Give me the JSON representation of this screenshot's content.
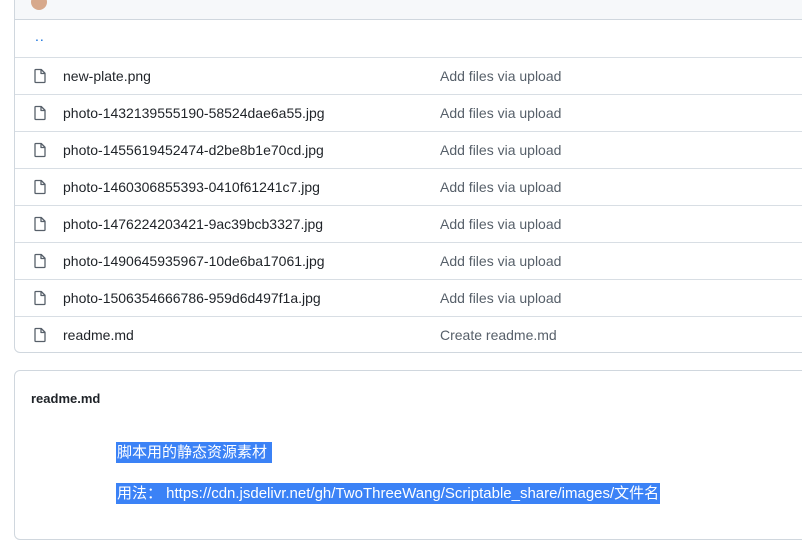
{
  "header": {
    "author_snippet": "…"
  },
  "parent_dir": "..",
  "files": [
    {
      "name": "new-plate.png",
      "commit": "Add files via upload"
    },
    {
      "name": "photo-1432139555190-58524dae6a55.jpg",
      "commit": "Add files via upload"
    },
    {
      "name": "photo-1455619452474-d2be8b1e70cd.jpg",
      "commit": "Add files via upload"
    },
    {
      "name": "photo-1460306855393-0410f61241c7.jpg",
      "commit": "Add files via upload"
    },
    {
      "name": "photo-1476224203421-9ac39bcb3327.jpg",
      "commit": "Add files via upload"
    },
    {
      "name": "photo-1490645935967-10de6ba17061.jpg",
      "commit": "Add files via upload"
    },
    {
      "name": "photo-1506354666786-959d6d497f1a.jpg",
      "commit": "Add files via upload"
    },
    {
      "name": "readme.md",
      "commit": "Create readme.md"
    }
  ],
  "readme": {
    "title": "readme.md",
    "line1": "脚本用的静态资源素材",
    "line2": "用法： https://cdn.jsdelivr.net/gh/TwoThreeWang/Scriptable_share/images/文件名"
  },
  "colors": {
    "link": "#0969da",
    "border": "#d0d7de",
    "highlight": "#3b82f6",
    "muted_text": "#57606a"
  }
}
